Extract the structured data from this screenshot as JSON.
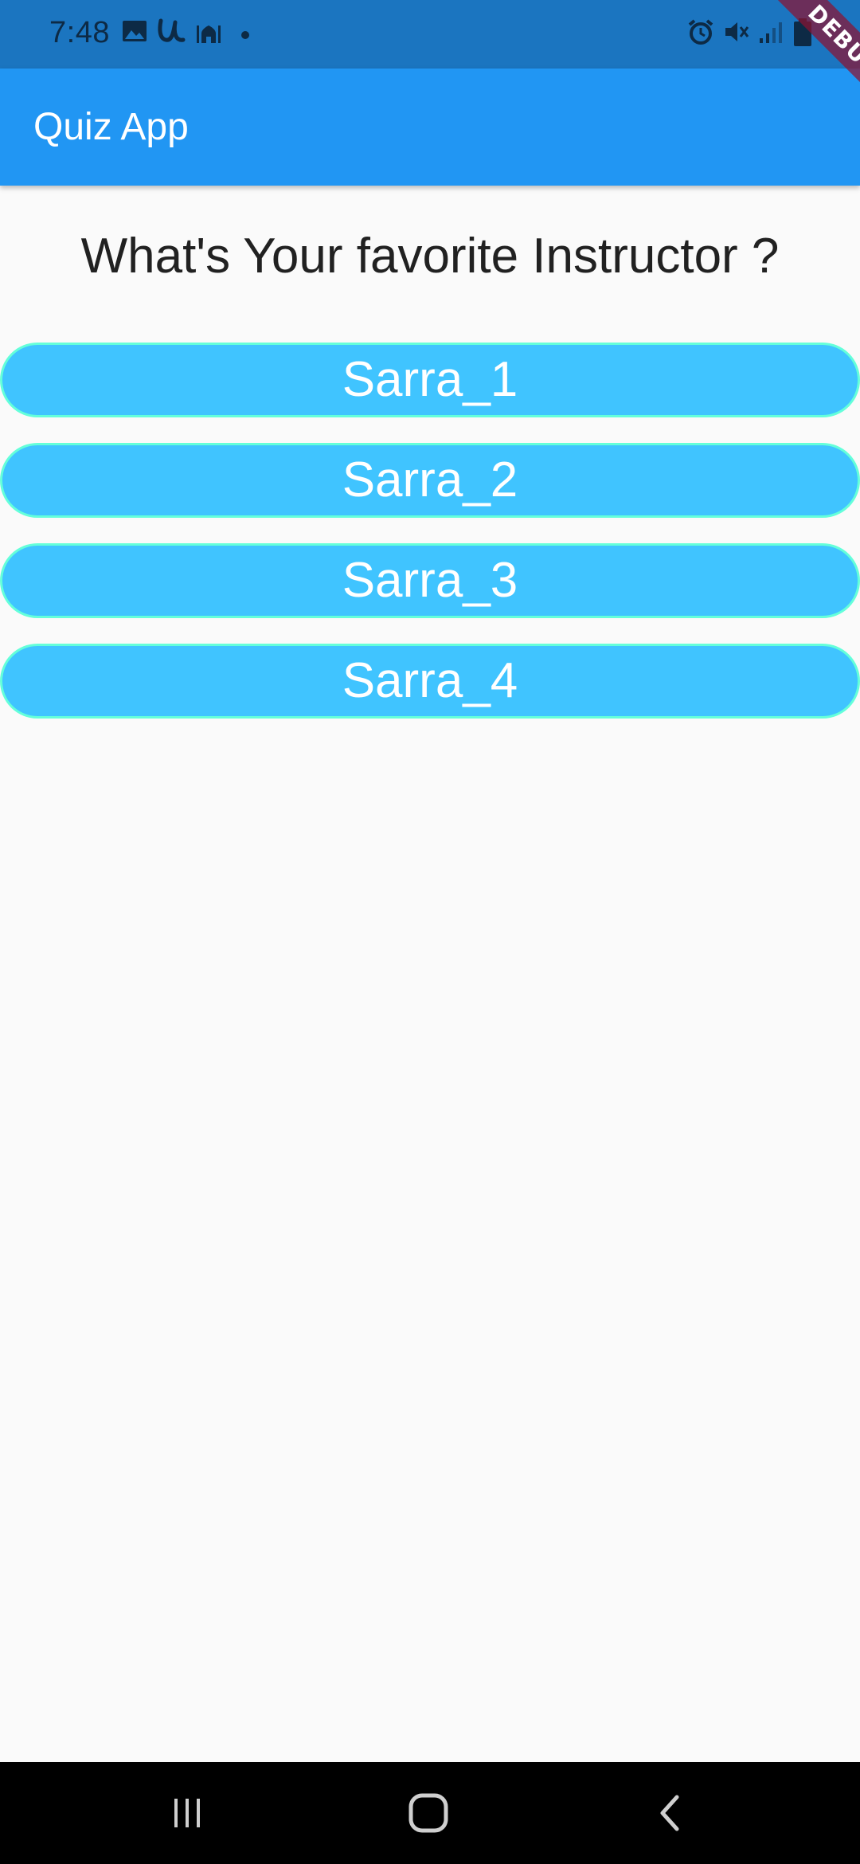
{
  "status_bar": {
    "time": "7:48",
    "icons_left": [
      "image-icon",
      "u-app-icon",
      "mosque-icon",
      "dot-icon"
    ],
    "icons_right": [
      "alarm-icon",
      "mute-icon",
      "signal-icon",
      "battery-icon"
    ]
  },
  "app_bar": {
    "title": "Quiz App"
  },
  "debug_banner": "DEBUG",
  "quiz": {
    "question": "What's Your favorite Instructor ?",
    "answers": [
      {
        "label": "Sarra_1"
      },
      {
        "label": "Sarra_2"
      },
      {
        "label": "Sarra_3"
      },
      {
        "label": "Sarra_4"
      }
    ]
  },
  "colors": {
    "app_bar": "#2196f3",
    "status_bar": "#1b75c0",
    "answer_fill": "#40c4ff",
    "answer_border": "#64ffda",
    "background": "#fafafa"
  },
  "nav_bar": {
    "buttons": [
      "recents-icon",
      "home-icon",
      "back-icon"
    ]
  }
}
